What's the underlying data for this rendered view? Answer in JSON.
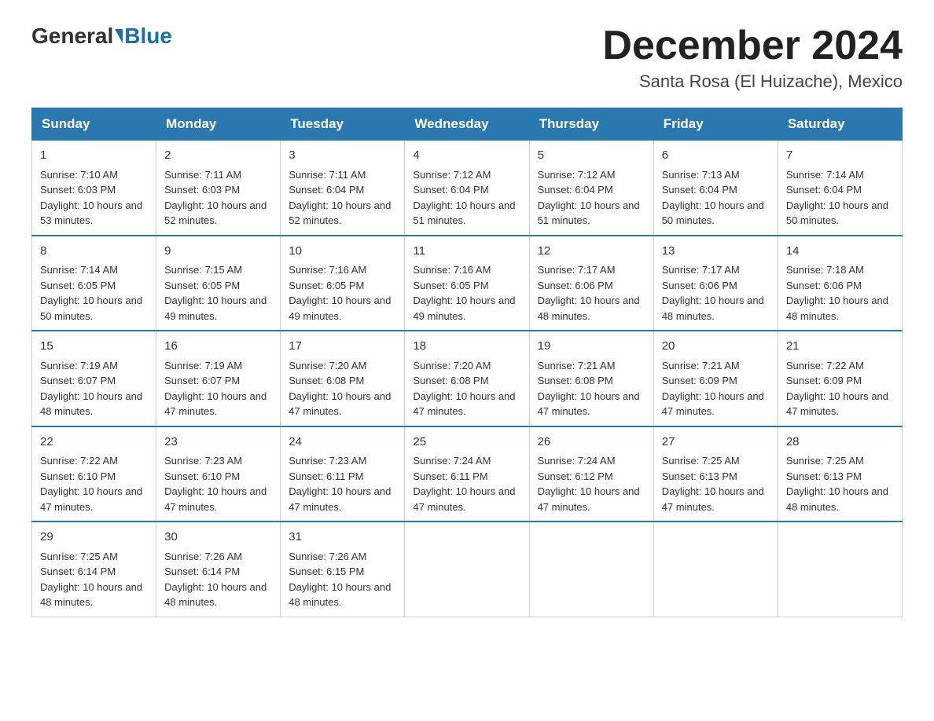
{
  "logo": {
    "general": "General",
    "blue": "Blue"
  },
  "header": {
    "month": "December 2024",
    "location": "Santa Rosa (El Huizache), Mexico"
  },
  "days_of_week": [
    "Sunday",
    "Monday",
    "Tuesday",
    "Wednesday",
    "Thursday",
    "Friday",
    "Saturday"
  ],
  "weeks": [
    [
      {
        "day": "1",
        "sunrise": "Sunrise: 7:10 AM",
        "sunset": "Sunset: 6:03 PM",
        "daylight": "Daylight: 10 hours and 53 minutes."
      },
      {
        "day": "2",
        "sunrise": "Sunrise: 7:11 AM",
        "sunset": "Sunset: 6:03 PM",
        "daylight": "Daylight: 10 hours and 52 minutes."
      },
      {
        "day": "3",
        "sunrise": "Sunrise: 7:11 AM",
        "sunset": "Sunset: 6:04 PM",
        "daylight": "Daylight: 10 hours and 52 minutes."
      },
      {
        "day": "4",
        "sunrise": "Sunrise: 7:12 AM",
        "sunset": "Sunset: 6:04 PM",
        "daylight": "Daylight: 10 hours and 51 minutes."
      },
      {
        "day": "5",
        "sunrise": "Sunrise: 7:12 AM",
        "sunset": "Sunset: 6:04 PM",
        "daylight": "Daylight: 10 hours and 51 minutes."
      },
      {
        "day": "6",
        "sunrise": "Sunrise: 7:13 AM",
        "sunset": "Sunset: 6:04 PM",
        "daylight": "Daylight: 10 hours and 50 minutes."
      },
      {
        "day": "7",
        "sunrise": "Sunrise: 7:14 AM",
        "sunset": "Sunset: 6:04 PM",
        "daylight": "Daylight: 10 hours and 50 minutes."
      }
    ],
    [
      {
        "day": "8",
        "sunrise": "Sunrise: 7:14 AM",
        "sunset": "Sunset: 6:05 PM",
        "daylight": "Daylight: 10 hours and 50 minutes."
      },
      {
        "day": "9",
        "sunrise": "Sunrise: 7:15 AM",
        "sunset": "Sunset: 6:05 PM",
        "daylight": "Daylight: 10 hours and 49 minutes."
      },
      {
        "day": "10",
        "sunrise": "Sunrise: 7:16 AM",
        "sunset": "Sunset: 6:05 PM",
        "daylight": "Daylight: 10 hours and 49 minutes."
      },
      {
        "day": "11",
        "sunrise": "Sunrise: 7:16 AM",
        "sunset": "Sunset: 6:05 PM",
        "daylight": "Daylight: 10 hours and 49 minutes."
      },
      {
        "day": "12",
        "sunrise": "Sunrise: 7:17 AM",
        "sunset": "Sunset: 6:06 PM",
        "daylight": "Daylight: 10 hours and 48 minutes."
      },
      {
        "day": "13",
        "sunrise": "Sunrise: 7:17 AM",
        "sunset": "Sunset: 6:06 PM",
        "daylight": "Daylight: 10 hours and 48 minutes."
      },
      {
        "day": "14",
        "sunrise": "Sunrise: 7:18 AM",
        "sunset": "Sunset: 6:06 PM",
        "daylight": "Daylight: 10 hours and 48 minutes."
      }
    ],
    [
      {
        "day": "15",
        "sunrise": "Sunrise: 7:19 AM",
        "sunset": "Sunset: 6:07 PM",
        "daylight": "Daylight: 10 hours and 48 minutes."
      },
      {
        "day": "16",
        "sunrise": "Sunrise: 7:19 AM",
        "sunset": "Sunset: 6:07 PM",
        "daylight": "Daylight: 10 hours and 47 minutes."
      },
      {
        "day": "17",
        "sunrise": "Sunrise: 7:20 AM",
        "sunset": "Sunset: 6:08 PM",
        "daylight": "Daylight: 10 hours and 47 minutes."
      },
      {
        "day": "18",
        "sunrise": "Sunrise: 7:20 AM",
        "sunset": "Sunset: 6:08 PM",
        "daylight": "Daylight: 10 hours and 47 minutes."
      },
      {
        "day": "19",
        "sunrise": "Sunrise: 7:21 AM",
        "sunset": "Sunset: 6:08 PM",
        "daylight": "Daylight: 10 hours and 47 minutes."
      },
      {
        "day": "20",
        "sunrise": "Sunrise: 7:21 AM",
        "sunset": "Sunset: 6:09 PM",
        "daylight": "Daylight: 10 hours and 47 minutes."
      },
      {
        "day": "21",
        "sunrise": "Sunrise: 7:22 AM",
        "sunset": "Sunset: 6:09 PM",
        "daylight": "Daylight: 10 hours and 47 minutes."
      }
    ],
    [
      {
        "day": "22",
        "sunrise": "Sunrise: 7:22 AM",
        "sunset": "Sunset: 6:10 PM",
        "daylight": "Daylight: 10 hours and 47 minutes."
      },
      {
        "day": "23",
        "sunrise": "Sunrise: 7:23 AM",
        "sunset": "Sunset: 6:10 PM",
        "daylight": "Daylight: 10 hours and 47 minutes."
      },
      {
        "day": "24",
        "sunrise": "Sunrise: 7:23 AM",
        "sunset": "Sunset: 6:11 PM",
        "daylight": "Daylight: 10 hours and 47 minutes."
      },
      {
        "day": "25",
        "sunrise": "Sunrise: 7:24 AM",
        "sunset": "Sunset: 6:11 PM",
        "daylight": "Daylight: 10 hours and 47 minutes."
      },
      {
        "day": "26",
        "sunrise": "Sunrise: 7:24 AM",
        "sunset": "Sunset: 6:12 PM",
        "daylight": "Daylight: 10 hours and 47 minutes."
      },
      {
        "day": "27",
        "sunrise": "Sunrise: 7:25 AM",
        "sunset": "Sunset: 6:13 PM",
        "daylight": "Daylight: 10 hours and 47 minutes."
      },
      {
        "day": "28",
        "sunrise": "Sunrise: 7:25 AM",
        "sunset": "Sunset: 6:13 PM",
        "daylight": "Daylight: 10 hours and 48 minutes."
      }
    ],
    [
      {
        "day": "29",
        "sunrise": "Sunrise: 7:25 AM",
        "sunset": "Sunset: 6:14 PM",
        "daylight": "Daylight: 10 hours and 48 minutes."
      },
      {
        "day": "30",
        "sunrise": "Sunrise: 7:26 AM",
        "sunset": "Sunset: 6:14 PM",
        "daylight": "Daylight: 10 hours and 48 minutes."
      },
      {
        "day": "31",
        "sunrise": "Sunrise: 7:26 AM",
        "sunset": "Sunset: 6:15 PM",
        "daylight": "Daylight: 10 hours and 48 minutes."
      },
      null,
      null,
      null,
      null
    ]
  ]
}
